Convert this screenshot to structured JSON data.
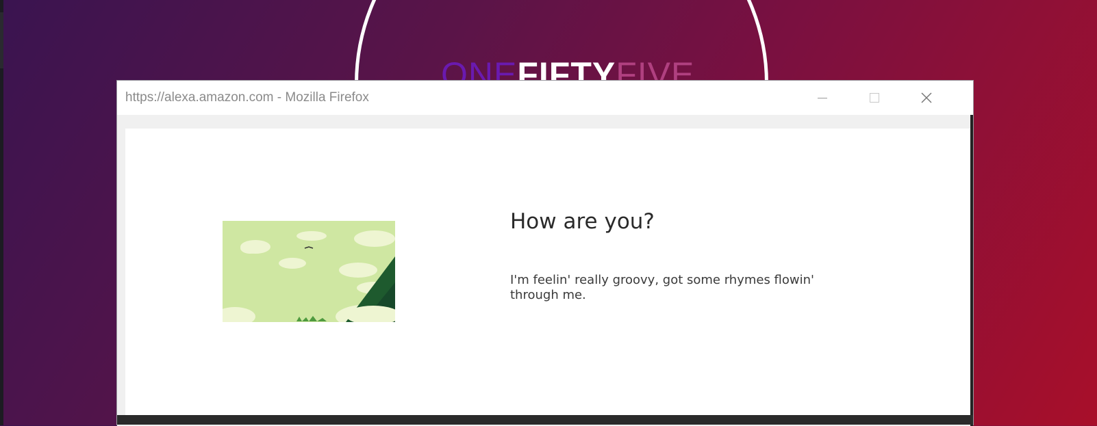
{
  "background": {
    "logo_parts": [
      "ONE",
      "FIFTY",
      "FIVE"
    ],
    "colors": {
      "gradient_start": "#3a1450",
      "gradient_end": "#a80f2a"
    }
  },
  "window": {
    "title": "https://alexa.amazon.com - Mozilla Firefox",
    "controls": {
      "minimize": "minimize-icon",
      "maximize": "maximize-icon",
      "close": "close-icon"
    }
  },
  "card": {
    "illustration": "landscape-clouds-trees",
    "title": "How are you?",
    "body": "I'm feelin' really groovy, got some rhymes flowin' through me."
  }
}
